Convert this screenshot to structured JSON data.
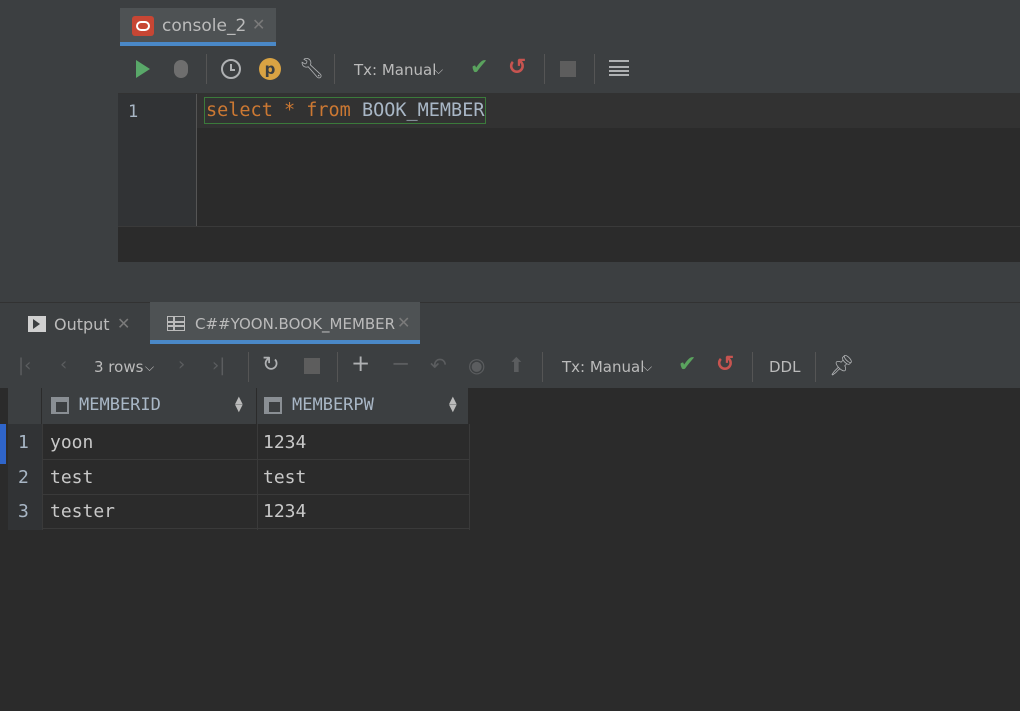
{
  "editor": {
    "tab_label": "console_2",
    "tab_close": "✕",
    "tx_mode": "Tx: Manual",
    "line_number": "1",
    "sql": {
      "kw_select": "select",
      "star": " * ",
      "kw_from": "from",
      "table": " BOOK_MEMBER"
    }
  },
  "results": {
    "tabs": [
      {
        "label": "Output",
        "close": "✕"
      },
      {
        "label": "C##YOON.BOOK_MEMBER",
        "close": "✕"
      }
    ],
    "rows_label": "3 rows",
    "tx_mode": "Tx: Manual",
    "ddl_label": "DDL",
    "columns": [
      "MEMBERID",
      "MEMBERPW"
    ],
    "rows": [
      {
        "num": "1",
        "memberid": "yoon",
        "memberpw": "1234"
      },
      {
        "num": "2",
        "memberid": "test",
        "memberpw": "test"
      },
      {
        "num": "3",
        "memberid": "tester",
        "memberpw": "1234"
      }
    ]
  },
  "colors": {
    "keyword": "#cc7832",
    "identifier": "#a9b7c6",
    "accent": "#4a88c7",
    "run": "#59a869",
    "commit": "#5aa35e",
    "rollback": "#c75450"
  },
  "icons": [
    "oracle-icon",
    "play-icon",
    "debug-icon",
    "clock-icon",
    "p-icon",
    "wrench-icon",
    "check-icon",
    "rollback-icon",
    "stop-icon",
    "list-icon",
    "output-icon",
    "grid-icon",
    "first-page-icon",
    "prev-page-icon",
    "next-page-icon",
    "last-page-icon",
    "refresh-icon",
    "stop-icon",
    "add-row-icon",
    "delete-row-icon",
    "revert-icon",
    "preview-icon",
    "submit-icon",
    "pin-icon",
    "sort-icon"
  ]
}
